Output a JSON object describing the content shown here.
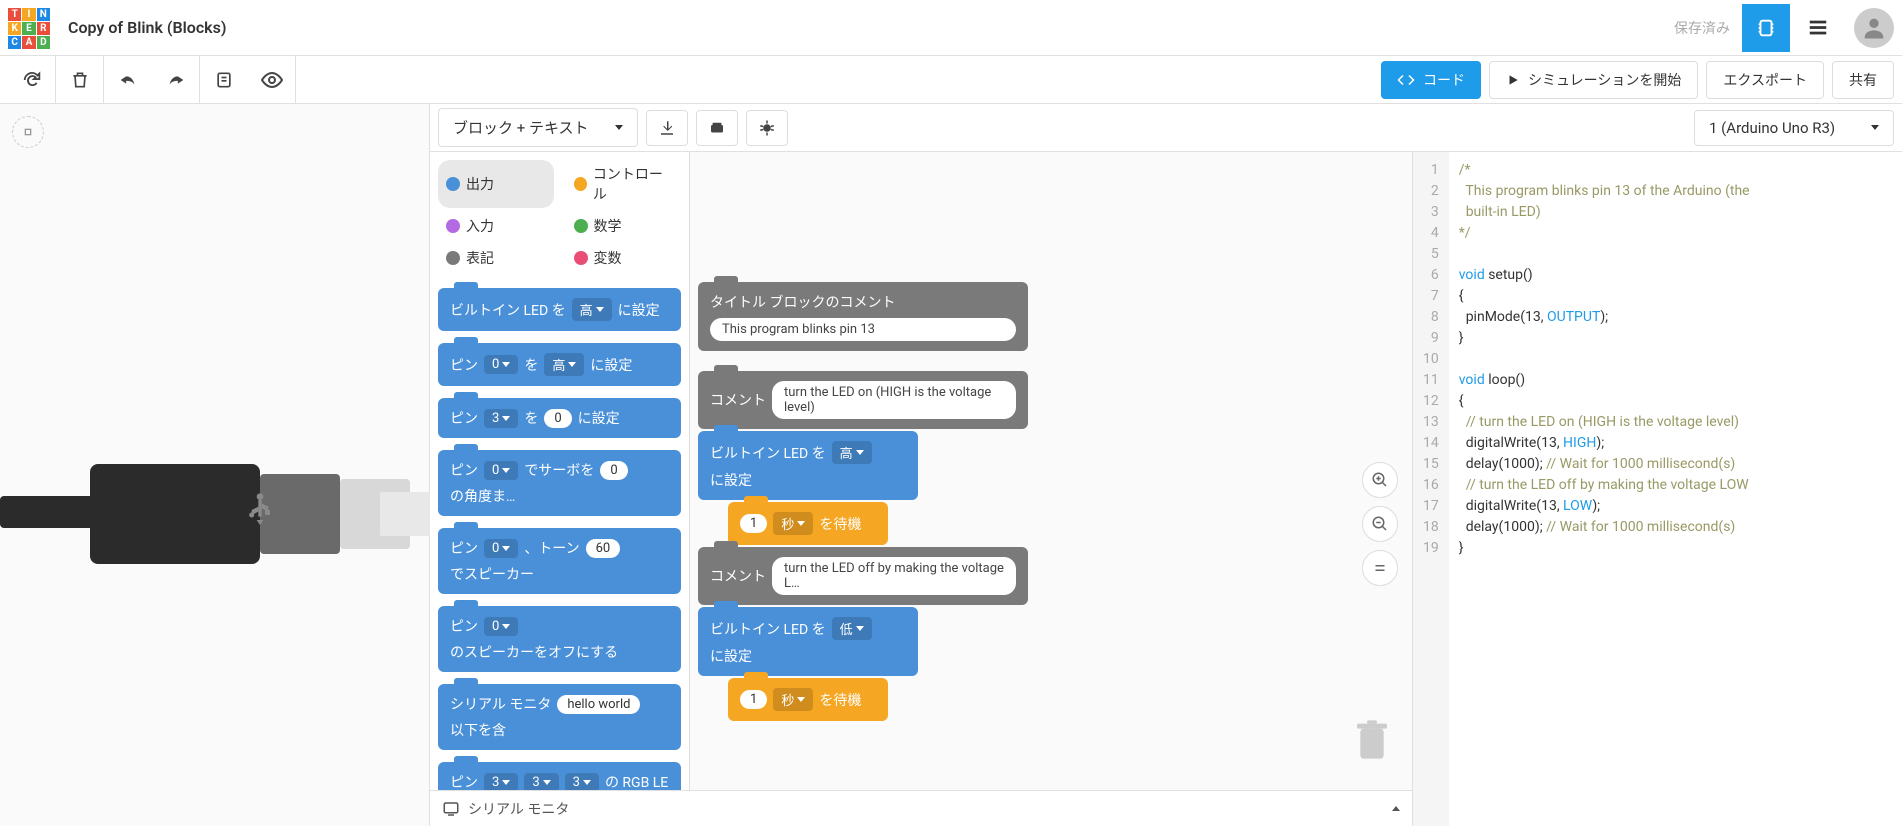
{
  "header": {
    "title": "Copy of Blink (Blocks)",
    "saved": "保存済み"
  },
  "toolbar": {
    "code": "コード",
    "simulate": "シミュレーションを開始",
    "export": "エクスポート",
    "share": "共有"
  },
  "codeToolbar": {
    "mode": "ブロック + テキスト",
    "board": "1 (Arduino Uno R3)"
  },
  "categories": [
    {
      "label": "出力",
      "color": "#4a90d9",
      "active": true
    },
    {
      "label": "コントロール",
      "color": "#f5a623"
    },
    {
      "label": "入力",
      "color": "#b36ae2"
    },
    {
      "label": "数学",
      "color": "#4caf50"
    },
    {
      "label": "表記",
      "color": "#7a7a7a"
    },
    {
      "label": "変数",
      "color": "#e94e77"
    }
  ],
  "paletteBlocks": {
    "b1_pre": "ビルトイン LED を",
    "b1_dd": "高",
    "b1_post": "に設定",
    "b2_pre": "ピン",
    "b2_pin": "0",
    "b2_mid": "を",
    "b2_dd": "高",
    "b2_post": "に設定",
    "b3_pre": "ピン",
    "b3_pin": "3",
    "b3_mid": "を",
    "b3_val": "0",
    "b3_post": "に設定",
    "b4_pre": "ピン",
    "b4_pin": "0",
    "b4_mid": "でサーボを",
    "b4_val": "0",
    "b4_post": "の角度ま…",
    "b5_pre": "ピン",
    "b5_pin": "0",
    "b5_mid": "、トーン",
    "b5_val": "60",
    "b5_post": "でスピーカー",
    "b6_pre": "ピン",
    "b6_pin": "0",
    "b6_post": "のスピーカーをオフにする",
    "b7_pre": "シリアル モニタ",
    "b7_val": "hello world",
    "b7_post": "以下を含",
    "b8_pre": "ピン",
    "b8_a": "3",
    "b8_b": "3",
    "b8_c": "3",
    "b8_post": "の RGB LE"
  },
  "workspace": {
    "titleComment": "タイトル ブロックのコメント",
    "titleValue": "This program blinks pin 13",
    "comment": "コメント",
    "comment1": "turn the LED on (HIGH is the voltage level)",
    "ledPre": "ビルトイン LED を",
    "ledHigh": "高",
    "ledLow": "低",
    "ledPost": "に設定",
    "waitVal": "1",
    "waitUnit": "秒",
    "waitPost": "を待機",
    "comment2": "turn the LED off by making the voltage L…"
  },
  "code": {
    "lines": [
      {
        "n": 1,
        "t": "/*",
        "cls": "c-comment"
      },
      {
        "n": 2,
        "t": "  This program blinks pin 13 of the Arduino (the",
        "cls": "c-comment"
      },
      {
        "n": 3,
        "t": "  built-in LED)",
        "cls": "c-comment"
      },
      {
        "n": 4,
        "t": "*/",
        "cls": "c-comment"
      },
      {
        "n": 5,
        "t": "",
        "cls": ""
      },
      {
        "n": 6,
        "t": "void setup()",
        "cls": ""
      },
      {
        "n": 7,
        "t": "{",
        "cls": ""
      },
      {
        "n": 8,
        "t": "  pinMode(13, OUTPUT);",
        "cls": ""
      },
      {
        "n": 9,
        "t": "}",
        "cls": ""
      },
      {
        "n": 10,
        "t": "",
        "cls": ""
      },
      {
        "n": 11,
        "t": "void loop()",
        "cls": ""
      },
      {
        "n": 12,
        "t": "{",
        "cls": ""
      },
      {
        "n": 13,
        "t": "  // turn the LED on (HIGH is the voltage level)",
        "cls": "c-comment"
      },
      {
        "n": 14,
        "t": "  digitalWrite(13, HIGH);",
        "cls": ""
      },
      {
        "n": 15,
        "t": "  delay(1000); // Wait for 1000 millisecond(s)",
        "cls": ""
      },
      {
        "n": 16,
        "t": "  // turn the LED off by making the voltage LOW",
        "cls": "c-comment"
      },
      {
        "n": 17,
        "t": "  digitalWrite(13, LOW);",
        "cls": ""
      },
      {
        "n": 18,
        "t": "  delay(1000); // Wait for 1000 millisecond(s)",
        "cls": ""
      },
      {
        "n": 19,
        "t": "}",
        "cls": ""
      }
    ]
  },
  "serialMonitor": "シリアル モニタ"
}
